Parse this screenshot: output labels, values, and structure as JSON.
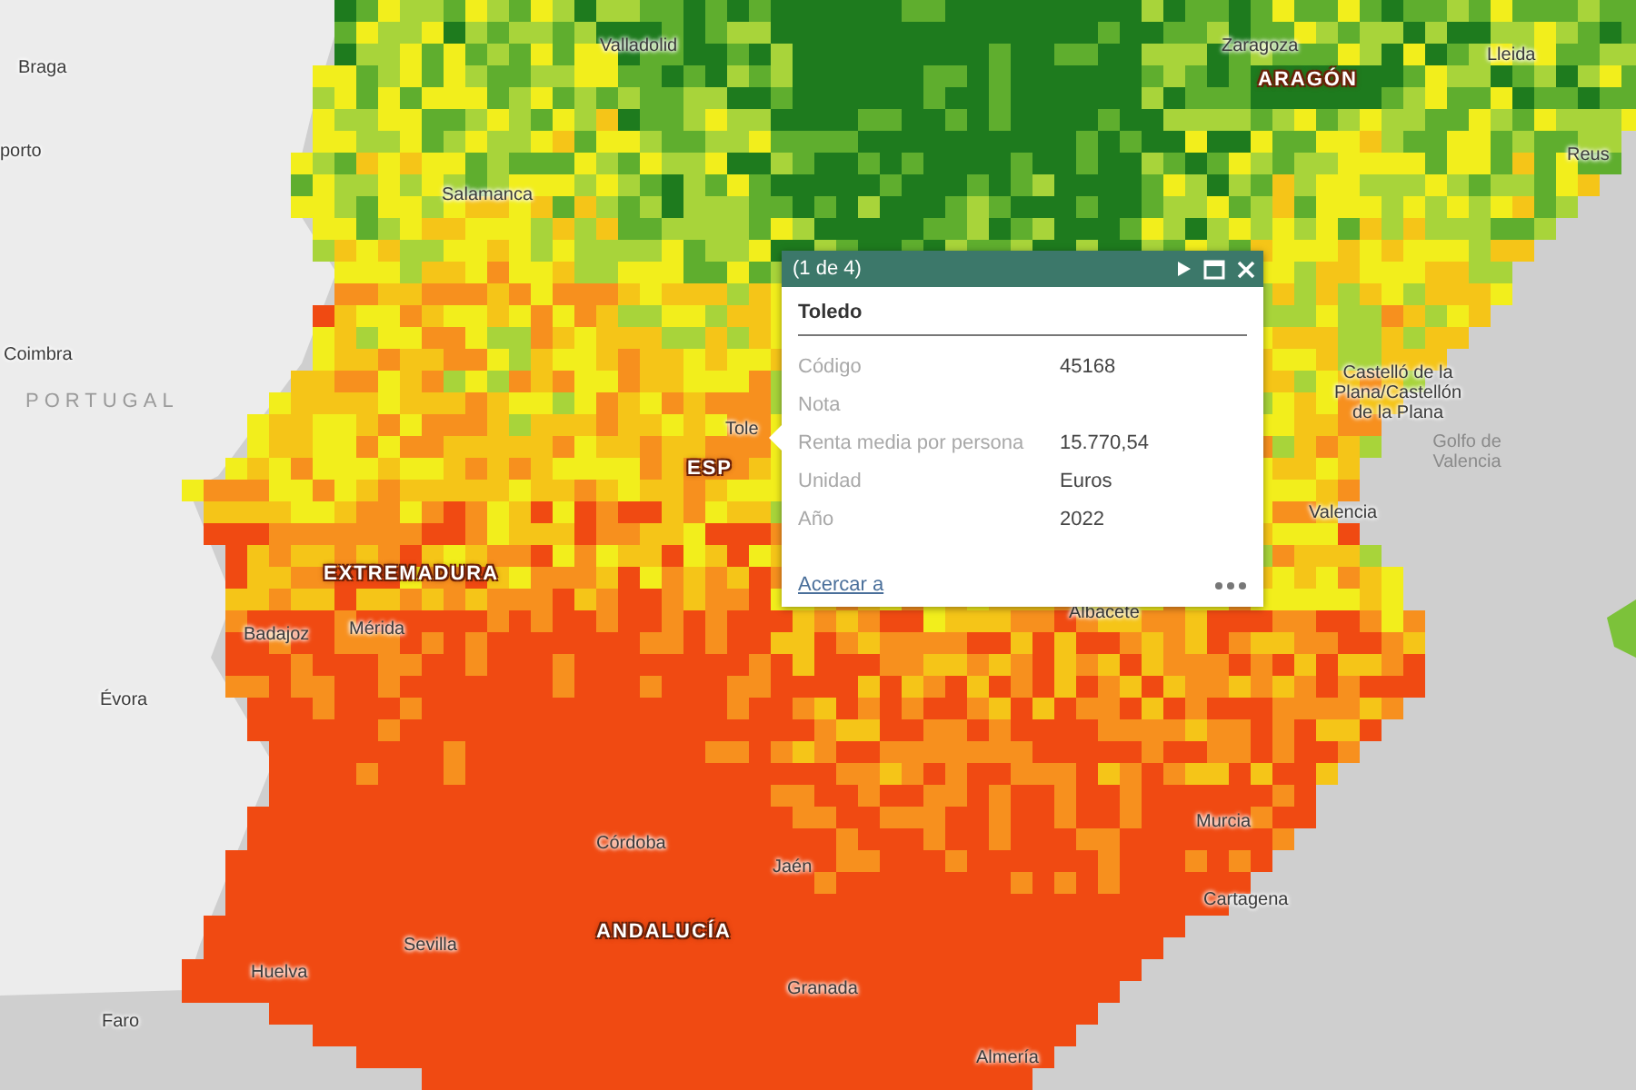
{
  "map": {
    "labels": [
      {
        "text": "Braga",
        "kind": "city"
      },
      {
        "text": "porto",
        "kind": "city"
      },
      {
        "text": "Coimbra",
        "kind": "city"
      },
      {
        "text": "PORTUGAL",
        "kind": "country"
      },
      {
        "text": "Valladolid",
        "kind": "city"
      },
      {
        "text": "Salamanca",
        "kind": "city"
      },
      {
        "text": "Zaragoza",
        "kind": "city"
      },
      {
        "text": "ARAGÓN",
        "kind": "region"
      },
      {
        "text": "Lleida",
        "kind": "city"
      },
      {
        "text": "Reus",
        "kind": "city"
      },
      {
        "text": "Castelló de la Plana/Castellón de la Plana",
        "kind": "city"
      },
      {
        "text": "Golfo de Valencia",
        "kind": "sea"
      },
      {
        "text": "Valencia",
        "kind": "city"
      },
      {
        "text": "Tole",
        "kind": "city"
      },
      {
        "text": "ESP",
        "kind": "region"
      },
      {
        "text": "EXTREMADURA",
        "kind": "region"
      },
      {
        "text": "Badajoz",
        "kind": "city"
      },
      {
        "text": "Mérida",
        "kind": "city"
      },
      {
        "text": "Évora",
        "kind": "city"
      },
      {
        "text": "Albacete",
        "kind": "city"
      },
      {
        "text": "Córdoba",
        "kind": "city"
      },
      {
        "text": "Jaén",
        "kind": "city"
      },
      {
        "text": "ANDALUCÍA",
        "kind": "region"
      },
      {
        "text": "Murcia",
        "kind": "city"
      },
      {
        "text": "Cartagena",
        "kind": "city"
      },
      {
        "text": "Sevilla",
        "kind": "city"
      },
      {
        "text": "Huelva",
        "kind": "city"
      },
      {
        "text": "Granada",
        "kind": "city"
      },
      {
        "text": "Faro",
        "kind": "city"
      },
      {
        "text": "Almería",
        "kind": "city"
      }
    ]
  },
  "popup": {
    "title": "(1 de 4)",
    "feature": "Toledo",
    "fields": [
      {
        "label": "Código",
        "value": "45168"
      },
      {
        "label": "Nota"
      },
      {
        "label": "Renta media por persona",
        "value": "15.770,54"
      },
      {
        "label": "Unidad",
        "value": "Euros"
      },
      {
        "label": "Año",
        "value": "2022"
      }
    ],
    "action": "Acercar a"
  }
}
